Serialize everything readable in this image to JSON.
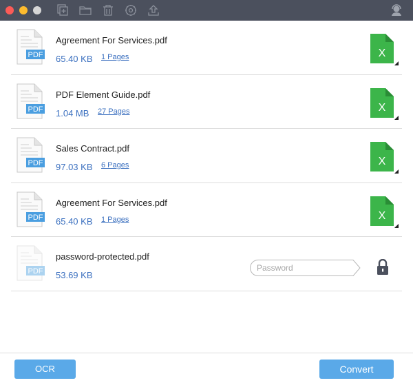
{
  "toolbar": {
    "window_controls": [
      "close",
      "minimize",
      "maximize"
    ],
    "icons": [
      "add-file-icon",
      "folder-icon",
      "trash-icon",
      "settings-icon",
      "upload-icon"
    ],
    "support_icon": "headset-support-icon"
  },
  "files": [
    {
      "name": "Agreement For Services.pdf",
      "size": "65.40 KB",
      "pages": "1 Pages",
      "output": "excel-icon"
    },
    {
      "name": "PDF Element Guide.pdf",
      "size": "1.04 MB",
      "pages": "27 Pages",
      "output": "excel-icon"
    },
    {
      "name": "Sales Contract.pdf",
      "size": "97.03 KB",
      "pages": "6 Pages",
      "output": "excel-icon"
    },
    {
      "name": "Agreement For Services.pdf",
      "size": "65.40 KB",
      "pages": "1 Pages",
      "output": "excel-icon"
    },
    {
      "name": "password-protected.pdf",
      "size": "53.69 KB",
      "password_placeholder": "Password",
      "password_value": "",
      "locked": true
    }
  ],
  "pdf_badge": "PDF",
  "excel_badge": "X",
  "footer": {
    "ocr_label": "OCR",
    "convert_label": "Convert"
  },
  "colors": {
    "titlebar": "#4b505d",
    "accent_blue": "#5aa9e8",
    "link_blue": "#3a6fbf",
    "excel_green": "#3cb54a"
  }
}
